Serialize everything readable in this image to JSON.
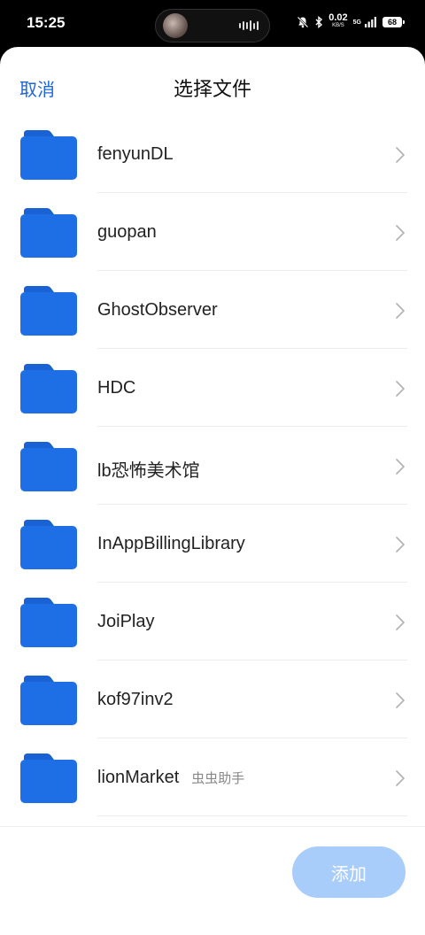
{
  "status_bar": {
    "time": "15:25",
    "net_speed": "0.02",
    "net_unit": "KB/S",
    "network": "5G",
    "battery": "68"
  },
  "header": {
    "cancel_label": "取消",
    "title": "选择文件"
  },
  "folders": [
    {
      "name": "fenyunDL",
      "tag": ""
    },
    {
      "name": "guopan",
      "tag": ""
    },
    {
      "name": "GhostObserver",
      "tag": ""
    },
    {
      "name": "HDC",
      "tag": ""
    },
    {
      "name": "lb恐怖美术馆",
      "tag": ""
    },
    {
      "name": "InAppBillingLibrary",
      "tag": ""
    },
    {
      "name": "JoiPlay",
      "tag": ""
    },
    {
      "name": "kof97inv2",
      "tag": ""
    },
    {
      "name": "lionMarket",
      "tag": "虫虫助手"
    }
  ],
  "footer": {
    "add_label": "添加"
  },
  "colors": {
    "accent": "#1a66d9",
    "folder": "#1e6ee6",
    "folder_tab": "#1a62d3",
    "add_disabled": "#a9cdfa"
  },
  "icons": {
    "folder": "folder-icon",
    "chevron": "chevron-right-icon"
  }
}
